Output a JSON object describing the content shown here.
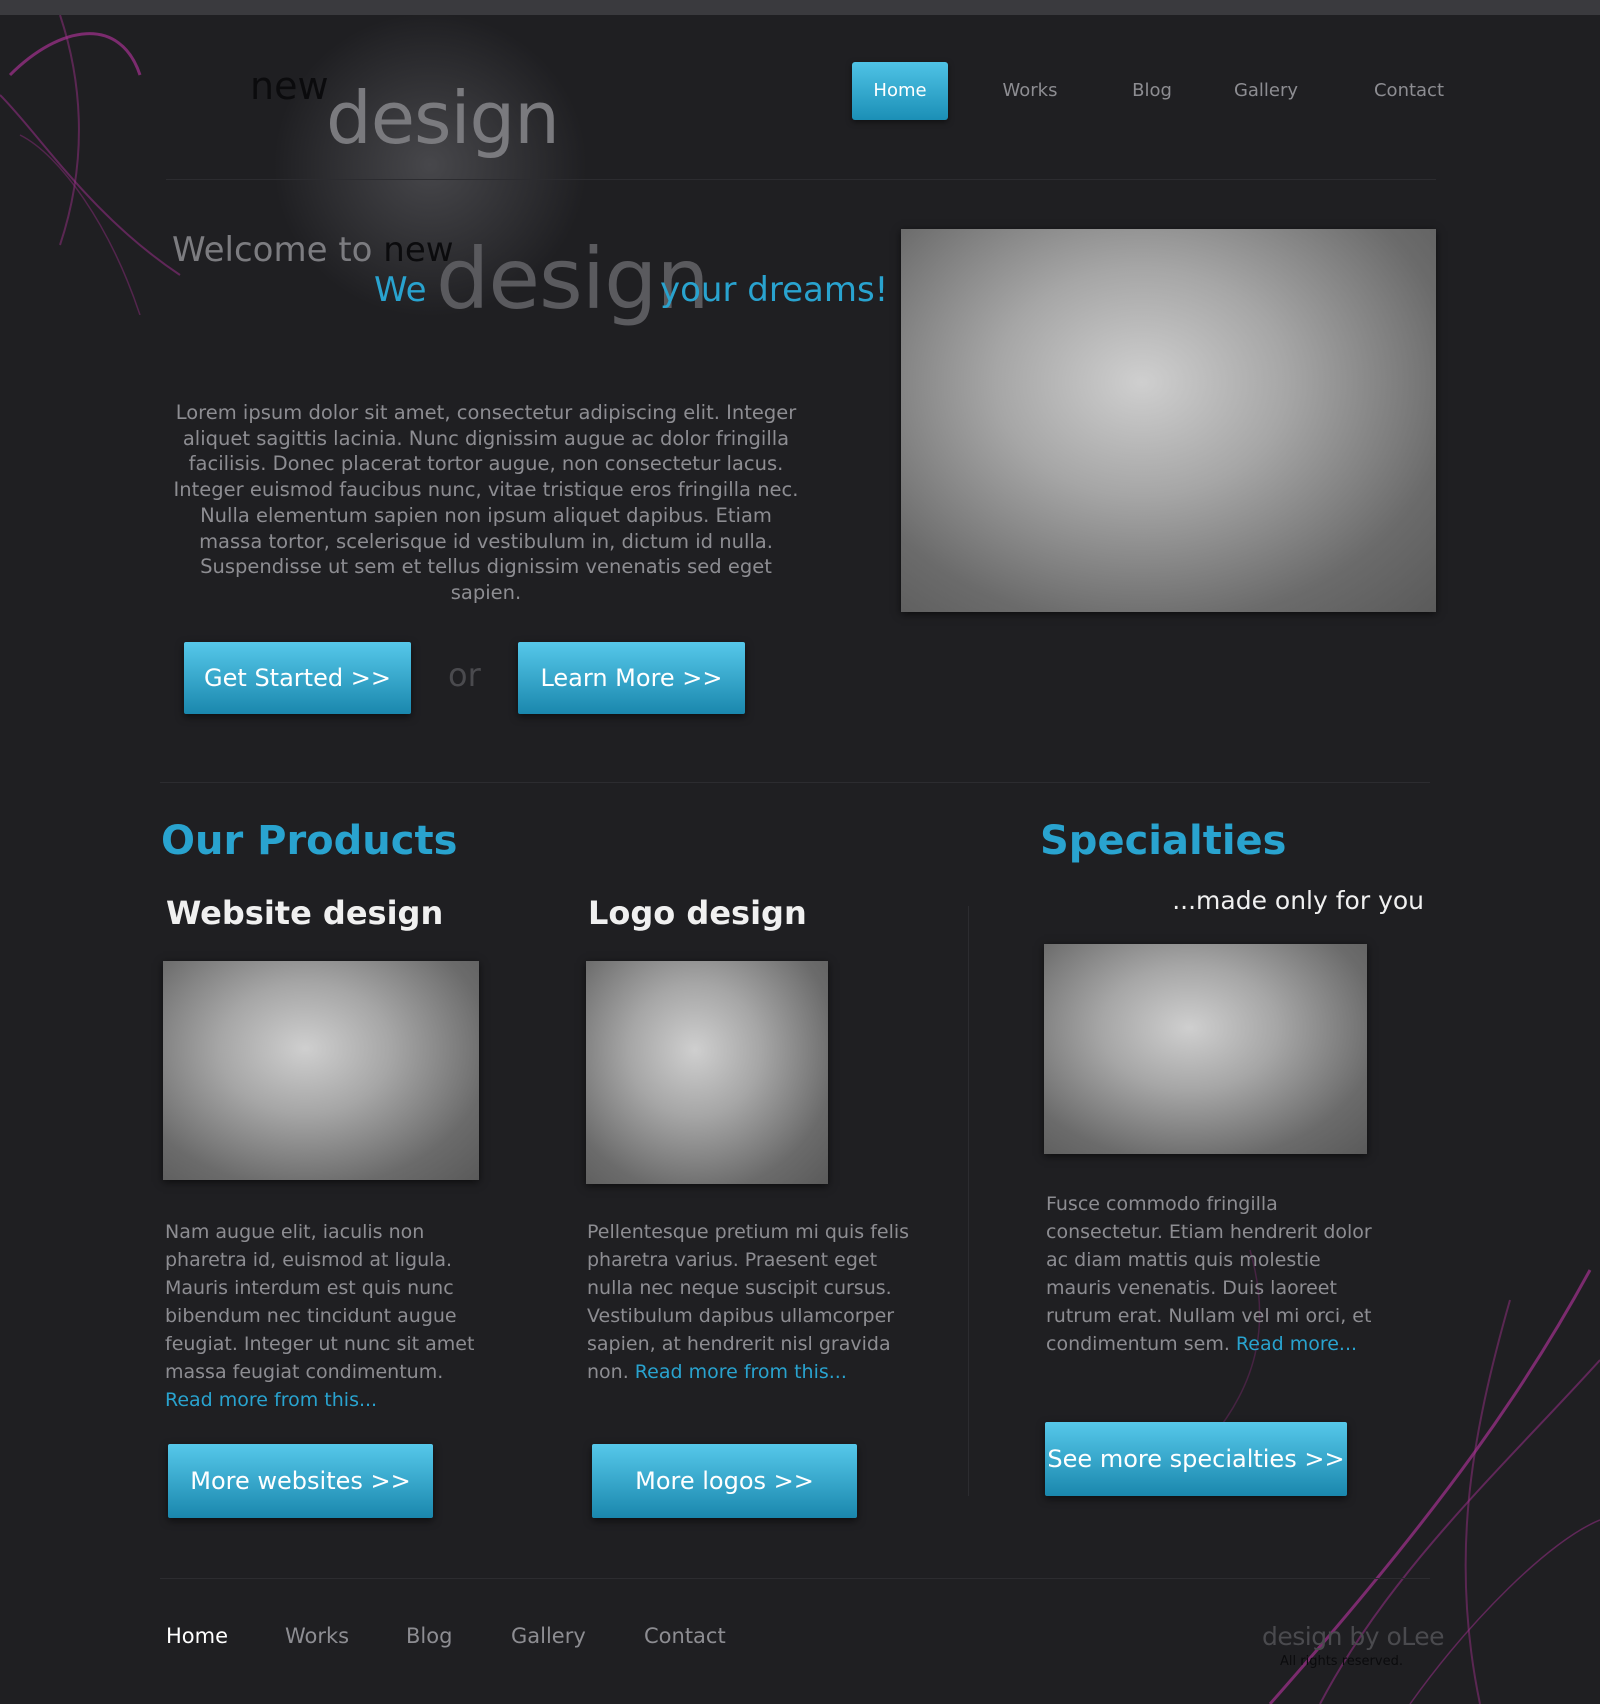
{
  "logo": {
    "new": "new",
    "design": "design"
  },
  "nav": {
    "items": [
      {
        "label": "Home"
      },
      {
        "label": "Works"
      },
      {
        "label": "Blog"
      },
      {
        "label": "Gallery"
      },
      {
        "label": "Contact"
      }
    ]
  },
  "hero": {
    "welcome": "Welcome to",
    "welcome_new": "new",
    "we": "We",
    "design": "design",
    "dreams": "your dreams!",
    "text": "Lorem ipsum dolor sit amet, consectetur adipiscing elit. Integer aliquet sagittis lacinia. Nunc dignissim augue ac dolor fringilla facilisis. Donec placerat tortor augue, non consectetur lacus. Integer euismod faucibus nunc, vitae tristique eros fringilla nec. Nulla elementum sapien non ipsum aliquet dapibus. Etiam massa tortor, scelerisque id vestibulum in, dictum id nulla. Suspendisse ut sem et tellus dignissim venenatis sed eget sapien.",
    "get_started": "Get Started >>",
    "or": "or",
    "learn_more": "Learn More >>"
  },
  "products": {
    "title": "Our Products",
    "website": {
      "title": "Website design",
      "text": "Nam augue elit, iaculis non pharetra id, euismod at ligula. Mauris interdum est quis nunc bibendum nec tincidunt augue feugiat. Integer ut nunc sit amet massa feugiat condimentum.",
      "link": "Read more from this...",
      "button": "More websites >>"
    },
    "logo": {
      "title": "Logo design",
      "text": "Pellentesque pretium mi quis felis pharetra varius. Praesent eget nulla nec neque suscipit cursus. Vestibulum dapibus ullamcorper sapien, at hendrerit nisl gravida non.",
      "link": "Read more from this...",
      "button": "More logos >>"
    }
  },
  "specialties": {
    "title": "Specialties",
    "tagline": "...made only for you",
    "text": "Fusce commodo fringilla consectetur. Etiam hendrerit dolor ac diam mattis quis molestie mauris venenatis. Duis laoreet rutrum erat. Nullam vel mi orci, et condimentum sem.",
    "link": "Read more...",
    "button": "See more specialties >>"
  },
  "footer": {
    "nav": [
      "Home",
      "Works",
      "Blog",
      "Gallery",
      "Contact"
    ],
    "credit": "design by  oLee",
    "rights": "All rights reserved."
  },
  "colors": {
    "background": "#1f1f22",
    "accent": "#29a3cf",
    "swirl": "#a2308f"
  }
}
